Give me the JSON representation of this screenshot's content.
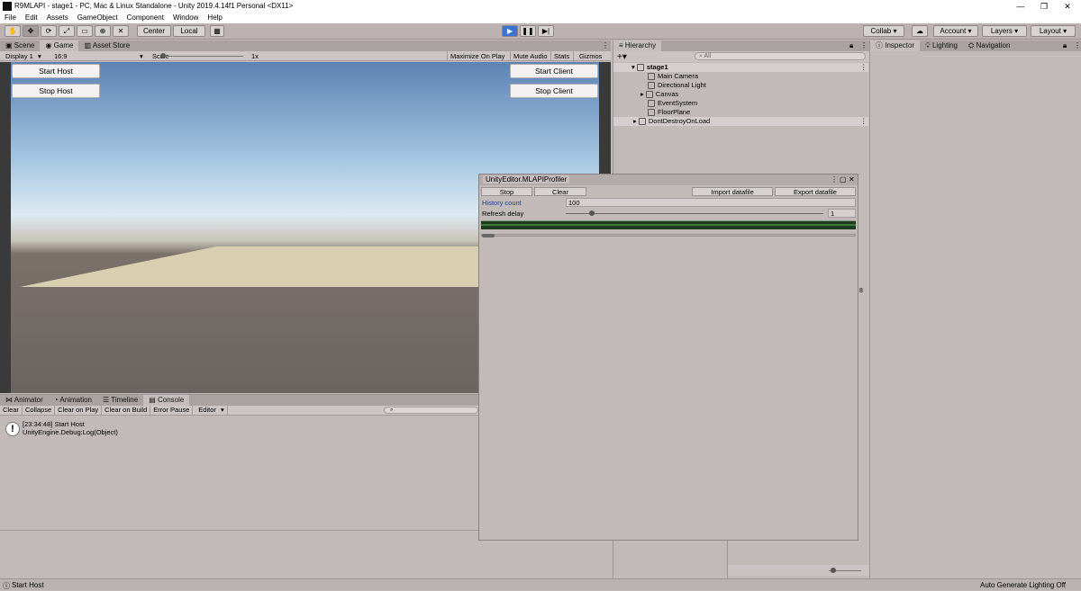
{
  "window": {
    "title": "R9MLAPI - stage1 - PC, Mac & Linux Standalone - Unity 2019.4.14f1 Personal <DX11>",
    "minimize": "—",
    "restore": "❐",
    "close": "✕"
  },
  "menu": [
    "File",
    "Edit",
    "Assets",
    "GameObject",
    "Component",
    "Window",
    "Help"
  ],
  "toolbar": {
    "center": "Center",
    "local": "Local",
    "collab": "Collab",
    "account": "Account",
    "layers": "Layers",
    "layout": "Layout"
  },
  "scene_tabs": [
    "Scene",
    "Game",
    "Asset Store"
  ],
  "game_toolbar": {
    "display": "Display 1",
    "aspect": "16:9",
    "scale_label": "Scale",
    "scale_value": "1x",
    "maximize": "Maximize On Play",
    "mute": "Mute Audio",
    "stats": "Stats",
    "gizmos": "Gizmos"
  },
  "game_buttons": {
    "start_host": "Start Host",
    "stop_host": "Stop Host",
    "start_client": "Start Client",
    "stop_client": "Stop Client"
  },
  "hierarchy": {
    "tab": "Hierarchy",
    "search_placeholder": "All",
    "scene": "stage1",
    "items": [
      "Main Camera",
      "Directional Light",
      "Canvas",
      "EventSystem",
      "FloorPlane"
    ],
    "dontdestroy": "DontDestroyOnLoad"
  },
  "right_tabs": [
    "Inspector",
    "Lighting",
    "Navigation"
  ],
  "profiler": {
    "title": "UnityEditor.MLAPIProfiler",
    "stop": "Stop",
    "clear": "Clear",
    "import": "Import datafile",
    "export": "Export datafile",
    "history_label": "History count",
    "history_value": "100",
    "refresh_label": "Refresh delay",
    "refresh_value": "1",
    "refresh_fraction": 0.1
  },
  "bottom_tabs": [
    "Animator",
    "Animation",
    "Timeline",
    "Console"
  ],
  "console": {
    "buttons": [
      "Clear",
      "Collapse",
      "Clear on Play",
      "Clear on Build",
      "Error Pause",
      "Editor"
    ],
    "log_line1": "[23:34:48] Start Host",
    "log_line2": "UnityEngine.Debug:Log(Object)"
  },
  "partial_label": "8",
  "status": {
    "message": "Start Host",
    "right": "Auto Generate Lighting Off"
  },
  "colors": {
    "play_button": "#3b74d0",
    "history_label": "#1b3fa0"
  }
}
